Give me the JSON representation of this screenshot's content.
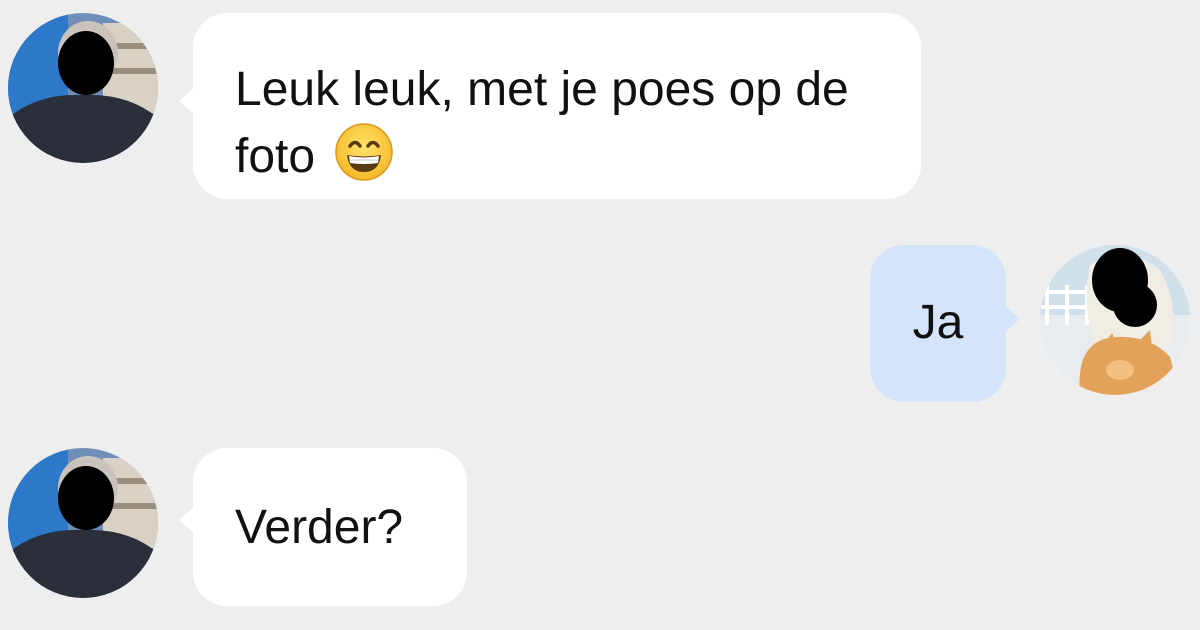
{
  "conversation": {
    "messages": [
      {
        "direction": "incoming",
        "text": "Leuk leuk, met je poes op de foto",
        "emoji": "grinning-face-with-smiling-eyes"
      },
      {
        "direction": "outgoing",
        "text": "Ja"
      },
      {
        "direction": "incoming",
        "text": "Verder?"
      }
    ]
  },
  "colors": {
    "background": "#eeeeee",
    "incoming_bubble": "#ffffff",
    "outgoing_bubble": "#d4e4fb",
    "text": "#111111"
  },
  "icons": {
    "sender_avatar": "man-photo-avatar-redacted",
    "receiver_avatar": "woman-with-cat-photo-avatar-redacted",
    "emoji": "grinning-face-emoji"
  }
}
